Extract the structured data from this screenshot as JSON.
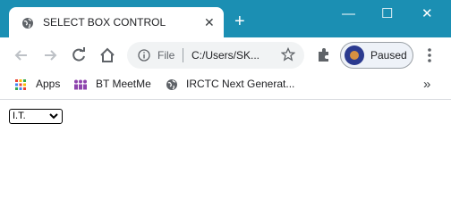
{
  "tab": {
    "title": "SELECT BOX CONTROL",
    "close": "✕",
    "icon": "globe-icon"
  },
  "newtab": "+",
  "window": {
    "minimize": "—",
    "maximize": "☐",
    "close": "✕"
  },
  "toolbar": {
    "icons": [
      "back-icon",
      "forward-icon",
      "reload-icon",
      "home-icon"
    ],
    "omnibox": {
      "scheme": "File",
      "url": "C:/Users/SK...",
      "info_icon": "info-icon",
      "star_icon": "star-icon"
    },
    "extensions_icon": "puzzle-icon",
    "profile": {
      "label": "Paused"
    },
    "menu_icon": "kebab-menu-icon"
  },
  "bookmarks": {
    "items": [
      {
        "label": "Apps",
        "icon": "apps-grid-icon"
      },
      {
        "label": "BT MeetMe",
        "icon": "meetme-icon"
      },
      {
        "label": "IRCTC Next Generat...",
        "icon": "globe-icon"
      }
    ],
    "overflow": "»"
  },
  "page": {
    "select": {
      "value": "I.T."
    }
  },
  "colors": {
    "titlebar": "#1b8fb3",
    "omnibox": "#f1f3f4"
  }
}
